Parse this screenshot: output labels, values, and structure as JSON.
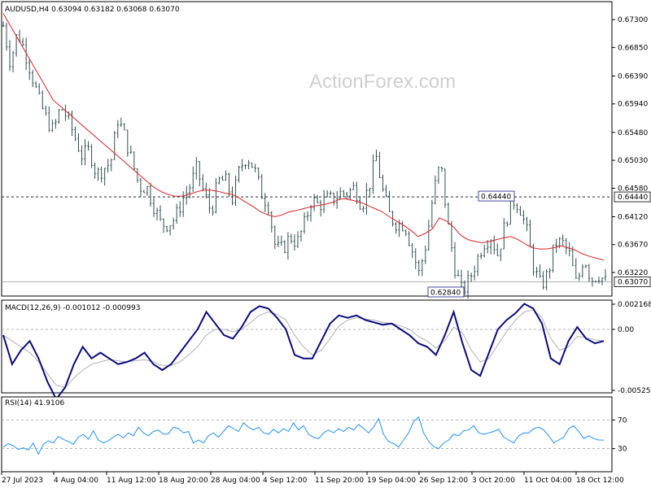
{
  "watermark": "ActionForex.com",
  "colors": {
    "price_bars": "#2f4f4f",
    "moving_average": "#e02020",
    "macd_line": "#0a0a80",
    "macd_signal": "#b0b0b0",
    "rsi_line": "#1e90ff",
    "frame": "#000000"
  },
  "chart_data": [
    {
      "type": "bar",
      "pane": "price",
      "title": "AUDUSD,H4  0.63094 0.63182 0.63068 0.63070",
      "y_ticks": [
        "0.67300",
        "0.66850",
        "0.66390",
        "0.65940",
        "0.65480",
        "0.65030",
        "0.64580",
        "0.64120",
        "0.63670",
        "0.63220"
      ],
      "ylim": [
        0.6284,
        0.6759
      ],
      "current_price": "0.63070",
      "level_line": "0.64440",
      "annotations": [
        "0.64440",
        "0.62840"
      ],
      "series": [
        {
          "type": "ohlc",
          "close_path": [
            0.672,
            0.666,
            0.671,
            0.668,
            0.664,
            0.66,
            0.657,
            0.655,
            0.659,
            0.657,
            0.654,
            0.651,
            0.652,
            0.648,
            0.649,
            0.65,
            0.657,
            0.654,
            0.65,
            0.646,
            0.646,
            0.643,
            0.64,
            0.64,
            0.641,
            0.644,
            0.646,
            0.649,
            0.645,
            0.642,
            0.647,
            0.647,
            0.644,
            0.649,
            0.651,
            0.649,
            0.645,
            0.643,
            0.636,
            0.636,
            0.638,
            0.637,
            0.64,
            0.644,
            0.643,
            0.644,
            0.644,
            0.645,
            0.645,
            0.646,
            0.643,
            0.646,
            0.651,
            0.645,
            0.641,
            0.64,
            0.64,
            0.636,
            0.632,
            0.637,
            0.645,
            0.65,
            0.64,
            0.633,
            0.629,
            0.631,
            0.634,
            0.637,
            0.638,
            0.635,
            0.64,
            0.644,
            0.643,
            0.639,
            0.633,
            0.63,
            0.632,
            0.637,
            0.637,
            0.635,
            0.63,
            0.635,
            0.631,
            0.632,
            0.6307
          ]
        },
        {
          "type": "line",
          "values": [
            0.674,
            0.672,
            0.67,
            0.668,
            0.666,
            0.664,
            0.662,
            0.66,
            0.659,
            0.658,
            0.657,
            0.656,
            0.655,
            0.654,
            0.653,
            0.652,
            0.651,
            0.65,
            0.649,
            0.648,
            0.647,
            0.646,
            0.6453,
            0.6448,
            0.6445,
            0.6445,
            0.6448,
            0.6452,
            0.6455,
            0.6455,
            0.6453,
            0.645,
            0.6448,
            0.6442,
            0.6435,
            0.6428,
            0.642,
            0.6415,
            0.6412,
            0.6415,
            0.642,
            0.6422,
            0.6425,
            0.6428,
            0.643,
            0.6432,
            0.6435,
            0.644,
            0.6441,
            0.6438,
            0.6435,
            0.643,
            0.6425,
            0.642,
            0.6412,
            0.6405,
            0.6398,
            0.639,
            0.638,
            0.6385,
            0.6392,
            0.641,
            0.6405,
            0.6395,
            0.6382,
            0.6375,
            0.6372,
            0.637,
            0.6372,
            0.6375,
            0.6378,
            0.638,
            0.6375,
            0.6368,
            0.6362,
            0.636,
            0.636,
            0.6362,
            0.6365,
            0.6362,
            0.6358,
            0.6352,
            0.6348,
            0.6345,
            0.6342
          ]
        }
      ]
    },
    {
      "type": "line",
      "pane": "macd",
      "title": "MACD(12,26,9) -0.001012 -0.000993",
      "y_ticks": [
        "0.002168",
        "0.00",
        "-0.00525"
      ],
      "ylim": [
        -0.00525,
        0.002168
      ],
      "series": [
        {
          "values": [
            -0.0005,
            -0.003,
            -0.0018,
            -0.001,
            -0.0025,
            -0.0045,
            -0.006,
            -0.005,
            -0.003,
            -0.0015,
            -0.0025,
            -0.002,
            -0.0025,
            -0.003,
            -0.0028,
            -0.0025,
            -0.002,
            -0.003,
            -0.0035,
            -0.003,
            -0.002,
            -0.001,
            0.0,
            0.0015,
            0.0005,
            -0.0005,
            -0.0008,
            0.0002,
            0.0015,
            0.002,
            0.0018,
            0.001,
            0.0,
            -0.0022,
            -0.0025,
            -0.0025,
            -0.001,
            0.0005,
            0.0012,
            0.001,
            0.0012,
            0.0008,
            0.0006,
            0.0004,
            0.0005,
            0.0,
            -0.0005,
            -0.0012,
            -0.0015,
            -0.0022,
            -0.0005,
            0.0015,
            -0.0012,
            -0.0035,
            -0.004,
            -0.002,
            0.0,
            0.0008,
            0.0014,
            0.0022,
            0.0018,
            0.0005,
            -0.0025,
            -0.003,
            -0.001,
            0.0002,
            -0.0008,
            -0.0012,
            -0.001
          ]
        },
        {
          "values": [
            -0.0005,
            -0.001,
            -0.0015,
            -0.002,
            -0.0028,
            -0.0038,
            -0.0048,
            -0.005,
            -0.0042,
            -0.0035,
            -0.003,
            -0.0028,
            -0.0026,
            -0.0027,
            -0.0028,
            -0.0027,
            -0.0026,
            -0.0028,
            -0.0031,
            -0.0031,
            -0.0028,
            -0.0022,
            -0.0015,
            -0.0005,
            0.0,
            0.0,
            -0.0002,
            0.0,
            0.0006,
            0.0012,
            0.0015,
            0.0013,
            0.0008,
            -0.0005,
            -0.0015,
            -0.0022,
            -0.0018,
            -0.0008,
            0.0003,
            0.0008,
            0.001,
            0.0009,
            0.0008,
            0.0006,
            0.0005,
            0.0003,
            0.0,
            -0.0006,
            -0.001,
            -0.0016,
            -0.001,
            0.0002,
            -0.0003,
            -0.0018,
            -0.0028,
            -0.0025,
            -0.0013,
            -0.0002,
            0.0008,
            0.0015,
            0.0017,
            0.001,
            -0.0008,
            -0.0018,
            -0.0015,
            -0.0006,
            -0.0007,
            -0.0009,
            -0.00099
          ]
        }
      ]
    },
    {
      "type": "line",
      "pane": "rsi",
      "title": "RSI(14) 41.9106",
      "y_ticks": [
        "70",
        "30"
      ],
      "ylim": [
        0,
        100
      ],
      "series": [
        {
          "values": [
            32,
            37,
            34,
            29,
            31,
            28,
            38,
            22,
            36,
            41,
            38,
            47,
            43,
            40,
            36,
            46,
            50,
            43,
            55,
            42,
            38,
            41,
            46,
            50,
            45,
            52,
            48,
            60,
            52,
            48,
            54,
            56,
            50,
            51,
            60,
            58,
            52,
            54,
            38,
            42,
            38,
            48,
            52,
            46,
            54,
            62,
            58,
            54,
            66,
            60,
            56,
            60,
            52,
            50,
            57,
            52,
            58,
            54,
            66,
            56,
            62,
            50,
            46,
            44,
            52,
            56,
            52,
            58,
            54,
            60,
            56,
            64,
            58,
            52,
            60,
            72,
            50,
            40,
            37,
            32,
            42,
            52,
            68,
            74,
            52,
            40,
            33,
            30,
            38,
            42,
            50,
            48,
            55,
            56,
            62,
            52,
            50,
            52,
            54,
            57,
            46,
            42,
            38,
            48,
            52,
            52,
            58,
            60,
            56,
            48,
            38,
            42,
            46,
            58,
            62,
            54,
            44,
            48,
            44,
            42,
            41.9
          ]
        }
      ]
    },
    {
      "type": "axis",
      "pane": "time-axis",
      "x_ticks": [
        "27 Jul 2023",
        "4 Aug 04:00",
        "11 Aug 12:00",
        "18 Aug 20:00",
        "28 Aug 04:00",
        "4 Sep 12:00",
        "11 Sep 20:00",
        "19 Sep 04:00",
        "26 Sep 12:00",
        "3 Oct 20:00",
        "11 Oct 04:00",
        "18 Oct 12:00"
      ]
    }
  ]
}
